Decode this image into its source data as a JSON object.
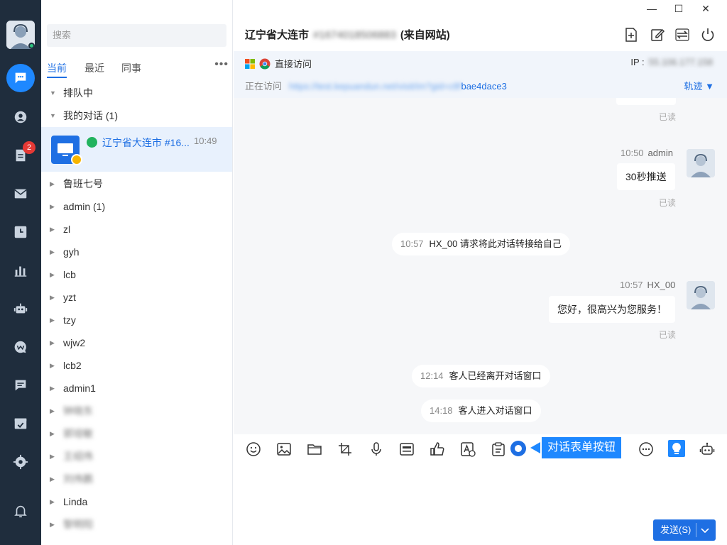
{
  "window": {
    "minimize": "—",
    "maximize": "☐",
    "close": "✕"
  },
  "sidebar": {
    "badge_count": "2",
    "items": [
      "chat",
      "contacts",
      "tickets",
      "mail",
      "history",
      "stats",
      "bot",
      "wechat",
      "messages",
      "tasks",
      "settings",
      "notifications"
    ]
  },
  "left_panel": {
    "search_placeholder": "搜索",
    "tabs": [
      "当前",
      "最近",
      "同事"
    ],
    "more": "•••",
    "groups": {
      "queue": "排队中",
      "my_conversations": "我的对话 (1)"
    },
    "active_conversation": {
      "name": "辽宁省大连市 #16...",
      "time": "10:49"
    },
    "colleagues": [
      "鲁班七号",
      "admin (1)",
      "zl",
      "gyh",
      "lcb",
      "yzt",
      "tzy",
      "wjw2",
      "lcb2",
      "admin1",
      "钟晓东",
      "郭培敏",
      "王绍伟",
      "刘伟鹏",
      "Linda",
      "黎明阳"
    ]
  },
  "header": {
    "title_prefix": "辽宁省大连市",
    "title_id": "#1674018506883",
    "title_suffix": "(来自网站)"
  },
  "visit": {
    "source": "直接访问",
    "ip_label": "IP :",
    "ip_value": "55.106.177.158",
    "visiting_label": "正在访问",
    "url_blurred": "https://test.kepuandun.net/visit/im?gid=c8f",
    "url_tail": "bae4dace3",
    "trace": "轨迹 ▼"
  },
  "chat": {
    "read": "已读",
    "msg1": {
      "time": "10:50",
      "sender": "admin",
      "text": "30秒推送"
    },
    "sys1": {
      "time": "10:57",
      "text": "HX_00 请求将此对话转接给自己"
    },
    "msg2": {
      "time": "10:57",
      "sender": "HX_00",
      "text": "您好，很高兴为您服务！"
    },
    "sys2": {
      "time": "12:14",
      "text": "客人已经离开对话窗口"
    },
    "sys3": {
      "time": "14:18",
      "text": "客人进入对话窗口"
    }
  },
  "toolbar": {
    "callout": "对话表单按钮",
    "tools": [
      "emoji",
      "image",
      "folder",
      "crop",
      "microphone",
      "card",
      "thumbs-up",
      "text-template",
      "clipboard",
      "form",
      "more",
      "bulb",
      "robot"
    ]
  },
  "send": {
    "label": "发送(S)"
  }
}
